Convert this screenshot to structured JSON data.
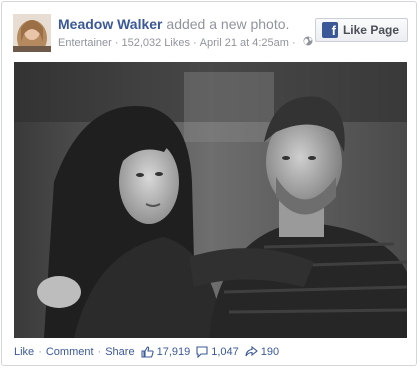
{
  "post": {
    "author": "Meadow Walker",
    "action": "added a new photo.",
    "category": "Entertainer",
    "likes_count": "152,032 Likes",
    "date": "April 21 at 4:25am",
    "privacy_icon": "globe-icon"
  },
  "like_page_button": {
    "label": "Like Page",
    "icon": "facebook-f-icon"
  },
  "footer": {
    "like": "Like",
    "comment": "Comment",
    "share": "Share",
    "likes": "17,919",
    "comments": "1,047",
    "shares": "190"
  },
  "colors": {
    "link": "#3b5998",
    "meta": "#90949c",
    "border": "#d3d6db"
  }
}
